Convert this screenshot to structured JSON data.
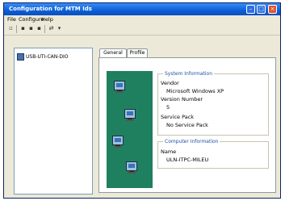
{
  "window": {
    "title": "Configuration for MTM Ids"
  },
  "menu": {
    "items": [
      "File",
      "Configure",
      "Help"
    ]
  },
  "toolbar": {
    "icons": [
      "new-icon",
      "save-icon",
      "copy-icon",
      "paste-icon",
      "connect-icon",
      "settings-icon"
    ]
  },
  "tree": {
    "items": [
      {
        "label": "USB-UTI-CAN-DIO"
      }
    ]
  },
  "tabs": [
    {
      "label": "General"
    },
    {
      "label": "Profile"
    }
  ],
  "system_info": {
    "legend": "System Information",
    "vendor_label": "Vendor",
    "vendor_value": "Microsoft Windows XP",
    "version_label": "Version Number",
    "version_value": "5",
    "service_label": "Service Pack",
    "service_value": "No Service Pack"
  },
  "computer_info": {
    "legend": "Computer Information",
    "name_label": "Name",
    "name_value": "ULN-ITPC-MILEU"
  }
}
